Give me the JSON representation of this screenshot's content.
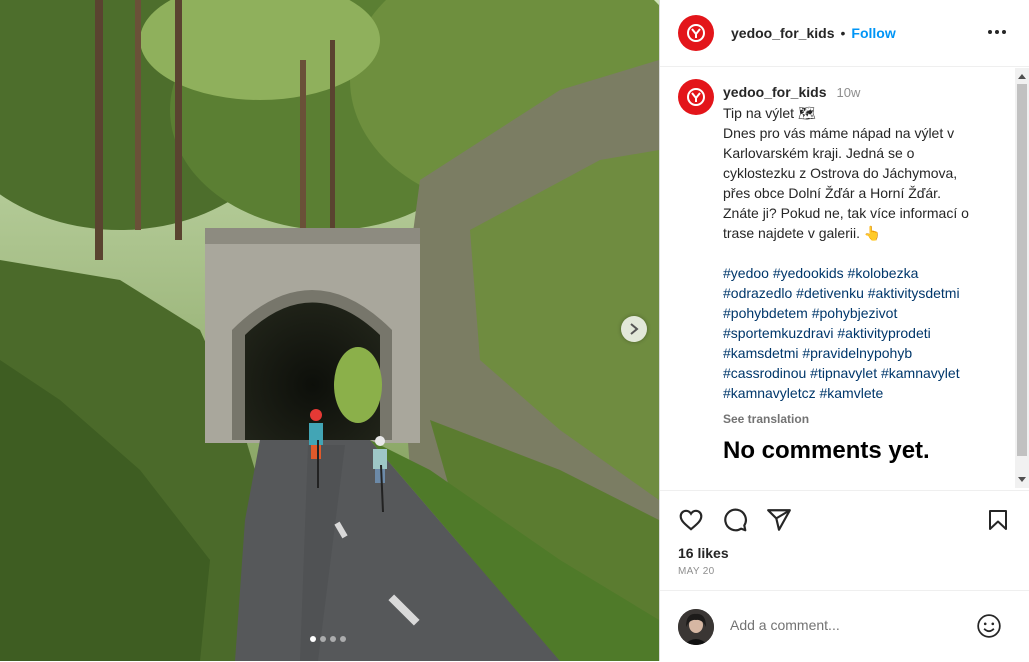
{
  "post": {
    "username": "yedoo_for_kids",
    "separator": "•",
    "follow_label": "Follow",
    "time_ago": "10w",
    "caption_lines": [
      "Tip na výlet 🗺",
      "",
      "Dnes pro vás máme nápad na výlet v",
      "Karlovarském kraji. Jedná se o",
      "cyklostezku z Ostrova do Jáchymova,",
      "přes obce Dolní Žďár a Horní Žďár.",
      "Znáte ji? Pokud ne, tak více informací o",
      "trase najdete v galerii. 👆"
    ],
    "hashtag_lines": [
      "#yedoo #yedookids #kolobezka",
      "#odrazedlo #detivenku #aktivitysdetmi",
      "#pohybdetem #pohybjezivot",
      "#sportemkuzdravi #aktivityprodeti",
      "#kamsdetmi #pravidelnypohyb",
      "#cassrodinou #tipnavylet #kamnavylet",
      "#kamnavyletcz #kamvlete"
    ],
    "see_translation": "See translation",
    "no_comments": "No comments yet.",
    "likes": "16 likes",
    "date": "MAY 20",
    "comment_placeholder": "Add a comment...",
    "carousel": {
      "slides": 4,
      "active": 1
    }
  },
  "icons": {
    "brand": "yedoo-logo-icon",
    "more": "more-options-icon",
    "like": "heart-icon",
    "comment": "comment-icon",
    "share": "share-icon",
    "save": "bookmark-icon",
    "emoji": "emoji-icon",
    "next": "chevron-right-icon"
  },
  "colors": {
    "brand_red": "#e3151a",
    "link_blue": "#0095f6",
    "hashtag": "#00376b"
  }
}
